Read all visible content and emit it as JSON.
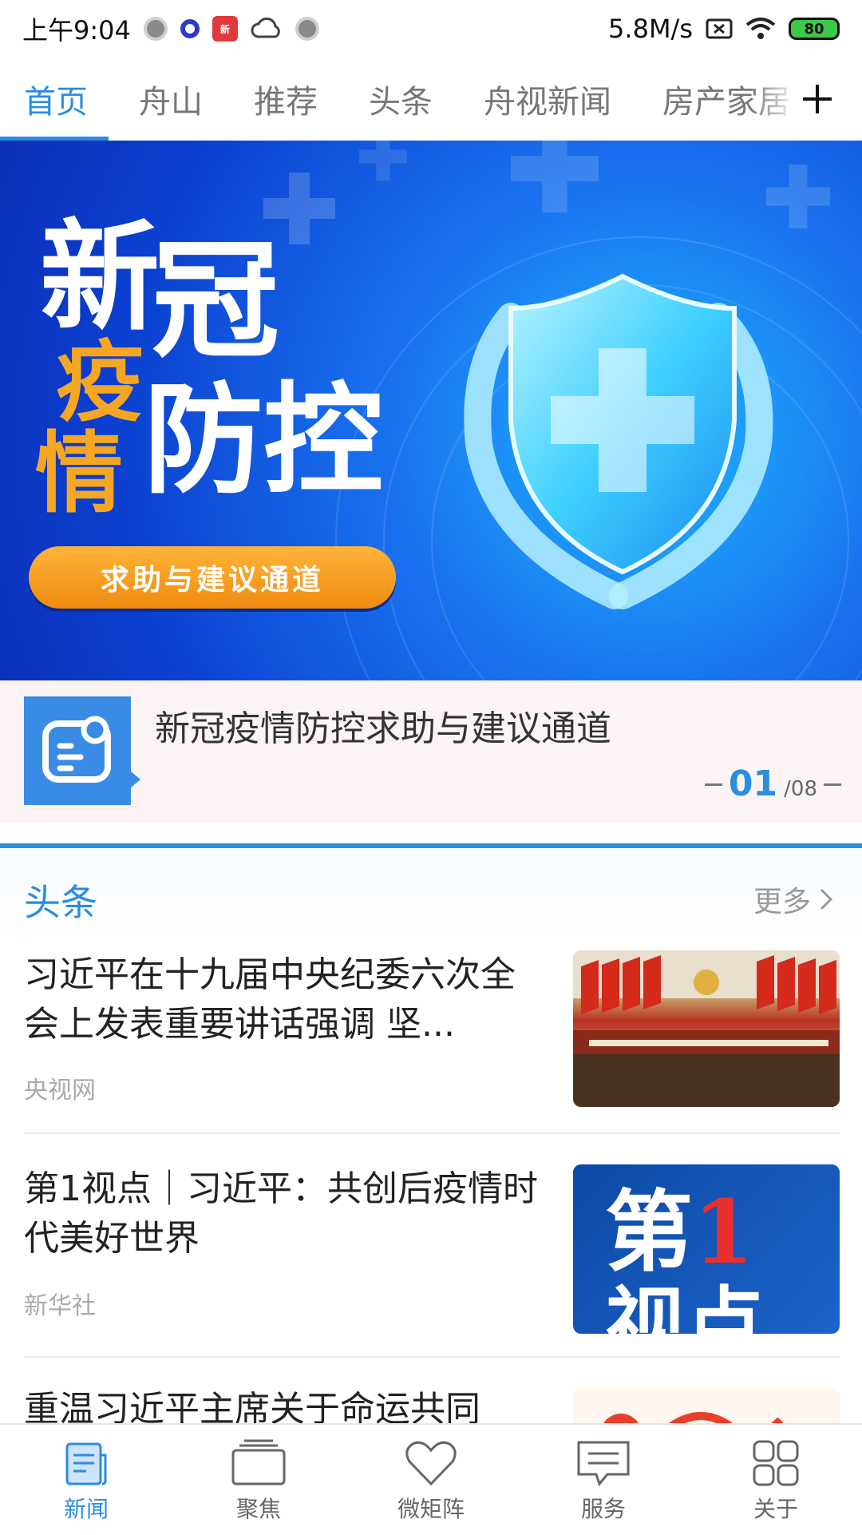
{
  "status_bar": {
    "time": "上午9:04",
    "red_app_label": "新",
    "net_speed": "5.8M/s",
    "battery": "80"
  },
  "tabs": [
    {
      "label": "首页",
      "active": true
    },
    {
      "label": "舟山",
      "active": false
    },
    {
      "label": "推荐",
      "active": false
    },
    {
      "label": "头条",
      "active": false
    },
    {
      "label": "舟视新闻",
      "active": false
    },
    {
      "label": "房产家居",
      "active": false
    }
  ],
  "banner": {
    "word1": "新",
    "word2": "冠",
    "word3": "疫",
    "word4": "情",
    "word5": "防控",
    "cta": "求助与建议通道"
  },
  "caption": {
    "title": "新冠疫情防控求助与建议通道",
    "current": "01",
    "total": "/08"
  },
  "section": {
    "title": "头条",
    "more": "更多"
  },
  "news": [
    {
      "title": "习近平在十九届中央纪委六次全会上发表重要讲话强调 坚...",
      "source": "央视网"
    },
    {
      "title": "第1视点｜习近平：共创后疫情时代美好世界",
      "source": "新华社",
      "thumb_text1": "第",
      "thumb_text2": "1",
      "thumb_text3": "视点"
    },
    {
      "title": "重温习近平主席关于命运共同",
      "source": ""
    }
  ],
  "bottom_nav": [
    {
      "label": "新闻",
      "icon": "news-icon",
      "active": true
    },
    {
      "label": "聚焦",
      "icon": "focus-icon",
      "active": false
    },
    {
      "label": "微矩阵",
      "icon": "heart-icon",
      "active": false
    },
    {
      "label": "服务",
      "icon": "message-icon",
      "active": false
    },
    {
      "label": "关于",
      "icon": "grid-icon",
      "active": false
    }
  ],
  "colors": {
    "accent": "#2a8de0",
    "banner_blue": "#1a74f0",
    "cta_orange": "#f39a1a"
  }
}
